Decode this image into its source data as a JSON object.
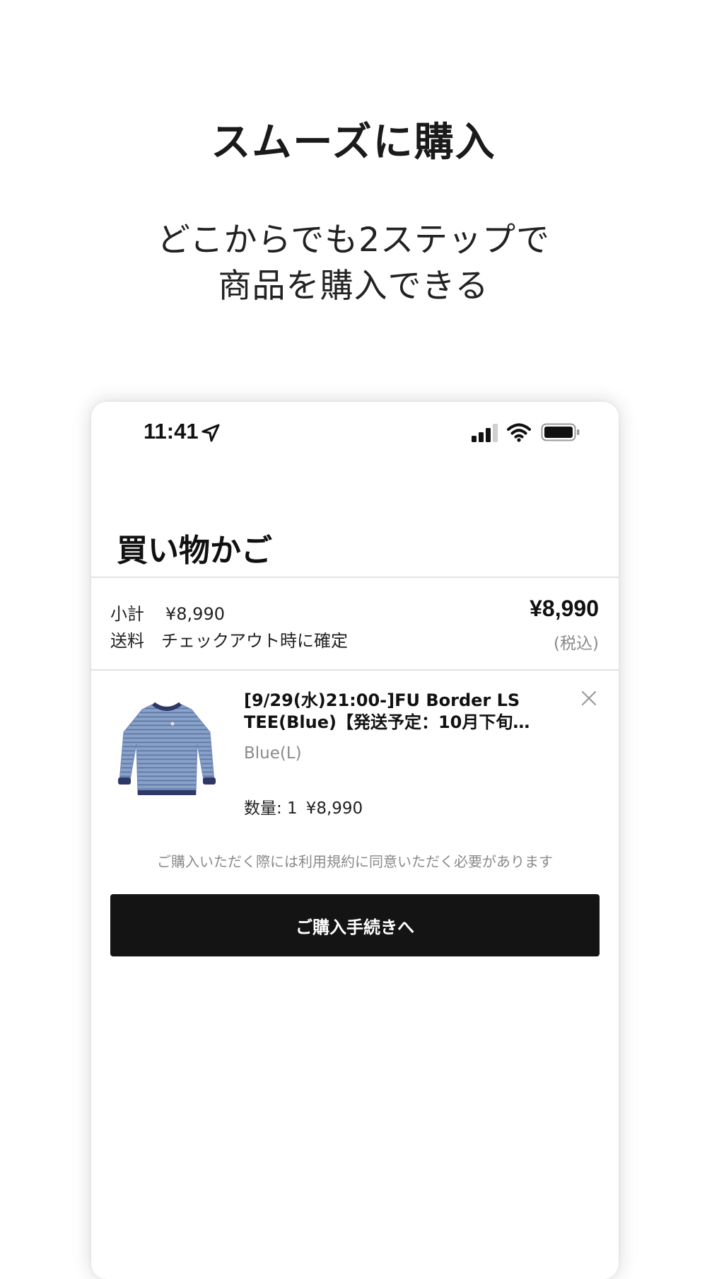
{
  "promo": {
    "title": "スムーズに購入",
    "subtitle_line1": "どこからでも2ステップで",
    "subtitle_line2": "商品を購入できる"
  },
  "status_bar": {
    "time": "11:41",
    "icons": [
      "location-arrow-icon",
      "cellular-signal-icon",
      "wifi-icon",
      "battery-icon"
    ]
  },
  "cart": {
    "title": "買い物かご",
    "subtotal_label": "小計",
    "subtotal_value": "¥8,990",
    "shipping_label": "送料",
    "shipping_value": "チェックアウト時に確定",
    "total": "¥8,990",
    "tax_note": "(税込)",
    "items": [
      {
        "name_line1": "[9/29(水)21:00-]FU Border LS",
        "name_line2": "TEE(Blue)【発送予定：10月下旬…",
        "variant": "Blue(L)",
        "quantity": "数量: 1",
        "price": "¥8,990",
        "thumbnail_icon": "striped-long-sleeve-shirt-icon",
        "remove_icon": "close-icon"
      }
    ],
    "terms_note": "ご購入いただく際には利用規約に同意いただく必要があります",
    "checkout_button": "ご購入手続きへ"
  },
  "colors": {
    "button_background": "#141414",
    "button_text": "#ffffff",
    "muted_text": "#8a8a8a",
    "shirt_blue": "#7e98c0",
    "shirt_navy": "#2e3766"
  }
}
